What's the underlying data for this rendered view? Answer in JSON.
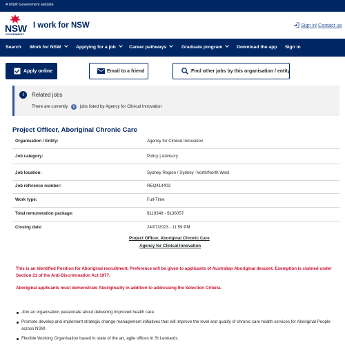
{
  "gov_bar": {
    "text": "A NSW Government website"
  },
  "header": {
    "logo_text": "NSW",
    "logo_subtext": "GOVERNMENT",
    "site_title": "I work for NSW",
    "sign_in": "Sign in",
    "separator": "|",
    "contact_us": "Contact us"
  },
  "nav": {
    "items": [
      {
        "label": "Search"
      },
      {
        "label": "Work for NSW"
      },
      {
        "label": "Applying for a job"
      },
      {
        "label": "Career pathways"
      },
      {
        "label": "Graduate program"
      },
      {
        "label": "Download the app"
      },
      {
        "label": "Sign in"
      }
    ]
  },
  "actions": {
    "apply": "Apply online",
    "email": "Email to a friend",
    "other_jobs": "Find other jobs by this organisation / entity"
  },
  "related": {
    "title": "Related jobs",
    "text_before": "There are currently",
    "count": "6",
    "text_after": "jobs listed by Agency for Clinical Innovation"
  },
  "job": {
    "title": "Project Officer, Aboriginal Chronic Care",
    "details": [
      {
        "label": "Organisation / Entity:",
        "value": "Agency for Clinical Innovation"
      },
      {
        "label": "Job category:",
        "value": "Policy | Advisory"
      },
      {
        "label": "Job location:",
        "value": "Sydney Region / Sydney -North/North West"
      },
      {
        "label": "Job reference number:",
        "value": "REQ414403"
      },
      {
        "label": "Work type:",
        "value": "Full-Time"
      },
      {
        "label": "Total remuneration package:",
        "value": "$119348 - $136057"
      },
      {
        "label": "Closing date:",
        "value": "24/07/2023 - 11:59 PM"
      }
    ],
    "link_title": "Project Officer, Aboriginal Chronic Care",
    "link_agency": "Agency for Clinical Innovation"
  },
  "notices": {
    "identified": "This is an Identified Position for Aboriginal recruitment. Preference will be given to applicants of Australian Aboriginal descent. Exemption is claimed under Section 21 of the Anti-Discrimination Act 1977.",
    "aboriginality": "Aboriginal applicants must demonstrate Aboriginality in addition to addressing the Selection Criteria."
  },
  "bullets": [
    "Join an organisation passionate about delivering improved health care.",
    "Promote develop and implement strategic change management initiatives that will improve the level and quality of chronic care health services for Aboriginal People across NSW.",
    "Flexible Working Organisation based in state of the art, agile offices in St Leonards."
  ],
  "colors": {
    "navy": "#002664",
    "link": "#2e5299",
    "alert_red": "#c8102e",
    "waratah_red": "#d7153a"
  },
  "icons": {
    "logo": "waratah-logo",
    "sign_in": "sign-in-icon",
    "apply": "checkbox-icon",
    "email": "envelope-icon",
    "search": "search-icon",
    "info": "info-icon"
  }
}
